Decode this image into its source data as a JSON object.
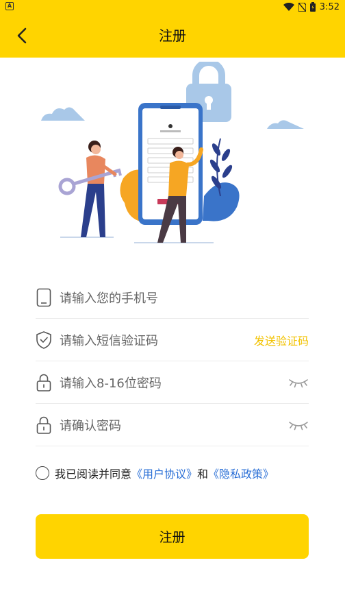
{
  "status_bar": {
    "left_badge": "A",
    "time": "3:52"
  },
  "app_bar": {
    "title": "注册"
  },
  "form": {
    "phone": {
      "placeholder": "请输入您的手机号"
    },
    "sms_code": {
      "placeholder": "请输入短信验证码",
      "action_label": "发送验证码"
    },
    "password": {
      "placeholder": "请输入8-16位密码"
    },
    "confirm_password": {
      "placeholder": "请确认密码"
    }
  },
  "agreement": {
    "prefix": "我已阅读并同意",
    "user_agreement": "《用户协议》",
    "conjunction": "和",
    "privacy_policy": "《隐私政策》"
  },
  "submit": {
    "label": "注册"
  },
  "colors": {
    "brand": "#ffd400",
    "link": "#2a6fd6",
    "action": "#f2c200"
  }
}
